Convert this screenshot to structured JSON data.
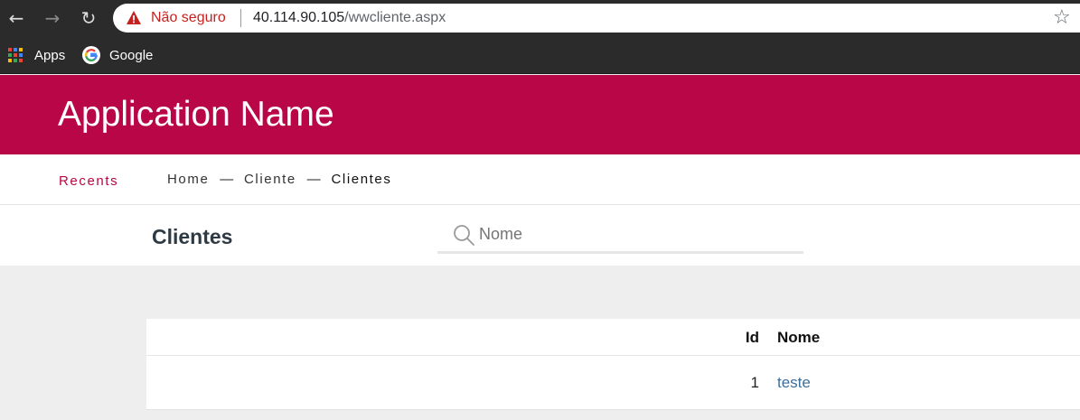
{
  "browser": {
    "security_label": "Não seguro",
    "url_host": "40.114.90.105",
    "url_path": "/wwcliente.aspx",
    "bookmarks": [
      {
        "label": "Apps"
      },
      {
        "label": "Google"
      }
    ]
  },
  "app": {
    "name": "Application Name",
    "brand_color": "#b80646"
  },
  "nav": {
    "recents_label": "Recents",
    "breadcrumb": [
      "Home",
      "Cliente",
      "Clientes"
    ],
    "separator": "—"
  },
  "page": {
    "title": "Clientes",
    "search": {
      "placeholder": "Nome",
      "value": ""
    }
  },
  "grid": {
    "columns": [
      "Id",
      "Nome"
    ],
    "rows": [
      {
        "id": "1",
        "nome": "teste"
      }
    ]
  }
}
